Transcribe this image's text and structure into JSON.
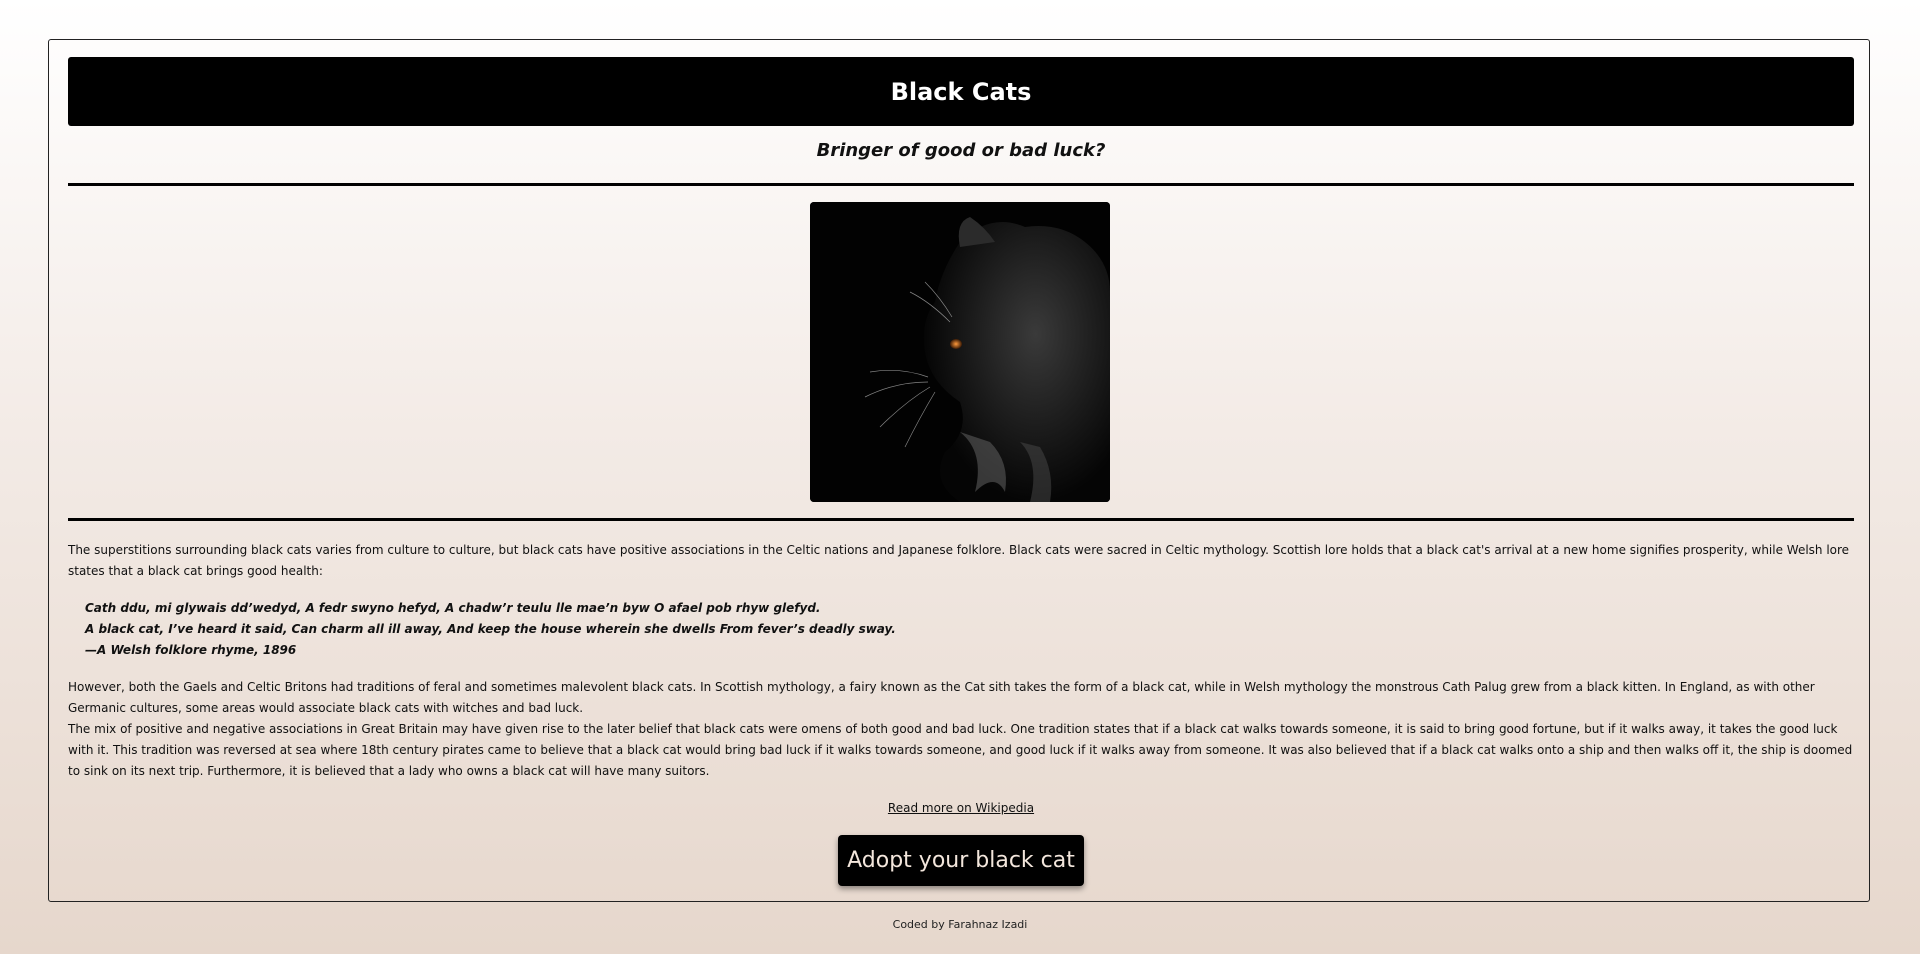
{
  "header": {
    "title": "Black Cats",
    "subtitle": "Bringer of good or bad luck?"
  },
  "image": {
    "icon": "black-cat-photo"
  },
  "content": {
    "intro": "The superstitions surrounding black cats varies from culture to culture, but black cats have positive associations in the Celtic nations and Japanese folklore. Black cats were sacred in Celtic mythology. Scottish lore holds that a black cat's arrival at a new home signifies prosperity, while Welsh lore states that a black cat brings good health:",
    "quote": {
      "line1": "Cath ddu, mi glywais dd’wedyd, A fedr swyno hefyd, A chadw’r teulu lle mae’n byw O afael pob rhyw glefyd.",
      "line2": "A black cat, I’ve heard it said, Can charm all ill away, And keep the house wherein she dwells From fever’s deadly sway.",
      "attribution": "—A Welsh folklore rhyme, 1896"
    },
    "paragraph2": "However, both the Gaels and Celtic Britons had traditions of feral and sometimes malevolent black cats. In Scottish mythology, a fairy known as the Cat sith takes the form of a black cat, while in Welsh mythology the monstrous Cath Palug grew from a black kitten. In England, as with other Germanic cultures, some areas would associate black cats with witches and bad luck.",
    "paragraph3": "The mix of positive and negative associations in Great Britain may have given rise to the later belief that black cats were omens of both good and bad luck. One tradition states that if a black cat walks towards someone, it is said to bring good fortune, but if it walks away, it takes the good luck with it. This tradition was reversed at sea where 18th century pirates came to believe that a black cat would bring bad luck if it walks towards someone, and good luck if it walks away from someone. It was also believed that if a black cat walks onto a ship and then walks off it, the ship is doomed to sink on its next trip. Furthermore, it is believed that a lady who owns a black cat will have many suitors."
  },
  "links": {
    "read_more": "Read more on Wikipedia"
  },
  "actions": {
    "adopt_label": "Adopt your black cat"
  },
  "footer": {
    "credit": "Coded by Farahnaz Izadi"
  },
  "colors": {
    "header_bg": "#000000",
    "button_text": "#f3e6dc",
    "bg_top": "#ffffff",
    "bg_bottom": "#e6d7cc"
  }
}
